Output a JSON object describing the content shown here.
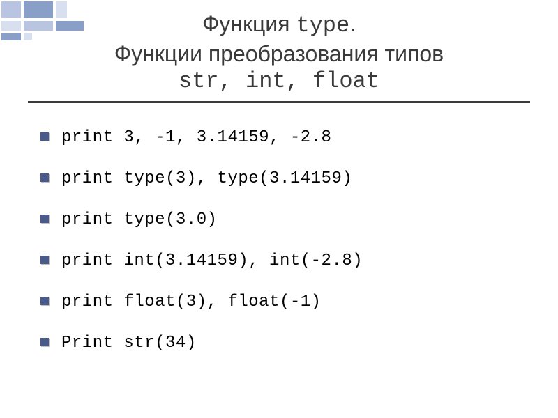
{
  "title": {
    "line1_prefix": "Функция ",
    "line1_mono": "type",
    "line1_suffix": ".",
    "line2": "Функции преобразования типов",
    "line3_mono": "str, int, float"
  },
  "bullets": [
    "print 3, -1, 3.14159, -2.8",
    "print type(3), type(3.14159)",
    "print type(3.0)",
    "print int(3.14159), int(-2.8)",
    "print float(3), float(-1)",
    "Print str(34)"
  ],
  "colors": {
    "accent": "#4a5a8a",
    "decor_light": "#d8dfee",
    "decor_mid": "#b8c4e0",
    "decor_dark": "#8a9fc8"
  }
}
